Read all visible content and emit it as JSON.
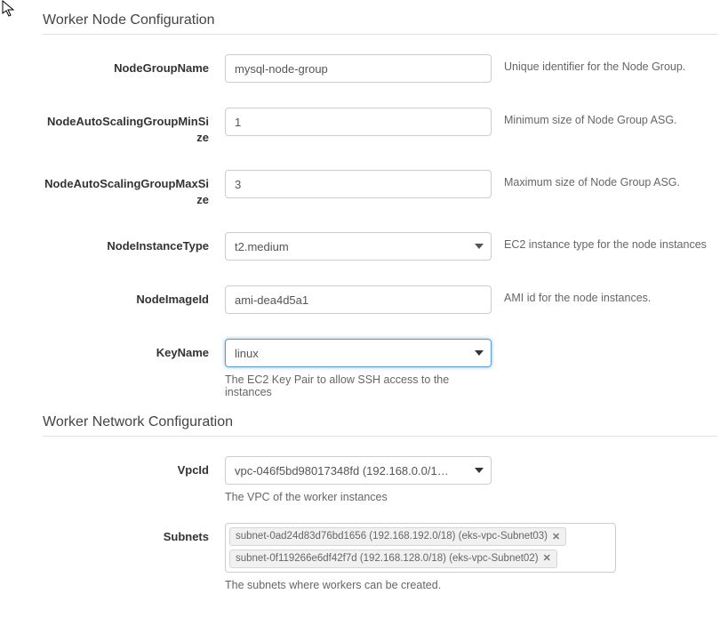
{
  "section1": {
    "heading": "Worker Node Configuration"
  },
  "section2": {
    "heading": "Worker Network Configuration"
  },
  "fields": {
    "nodeGroupName": {
      "label": "NodeGroupName",
      "value": "mysql-node-group",
      "desc": "Unique identifier for the Node Group."
    },
    "asgMin": {
      "label": "NodeAutoScalingGroupMinSize",
      "value": "1",
      "desc": "Minimum size of Node Group ASG."
    },
    "asgMax": {
      "label": "NodeAutoScalingGroupMaxSize",
      "value": "3",
      "desc": "Maximum size of Node Group ASG."
    },
    "instanceType": {
      "label": "NodeInstanceType",
      "value": "t2.medium",
      "desc": "EC2 instance type for the node instances"
    },
    "imageId": {
      "label": "NodeImageId",
      "value": "ami-dea4d5a1",
      "desc": "AMI id for the node instances."
    },
    "keyName": {
      "label": "KeyName",
      "value": "linux",
      "belowHelp": "The EC2 Key Pair to allow SSH access to the instances"
    },
    "vpcId": {
      "label": "VpcId",
      "value": "vpc-046f5bd98017348fd (192.168.0.0/1…",
      "belowHelp": "The VPC of the worker instances"
    },
    "subnets": {
      "label": "Subnets",
      "tags": [
        "subnet-0ad24d83d76bd1656 (192.168.192.0/18) (eks-vpc-Subnet03)",
        "subnet-0f119266e6df42f7d (192.168.128.0/18) (eks-vpc-Subnet02)"
      ],
      "belowHelp": "The subnets where workers can be created."
    }
  }
}
